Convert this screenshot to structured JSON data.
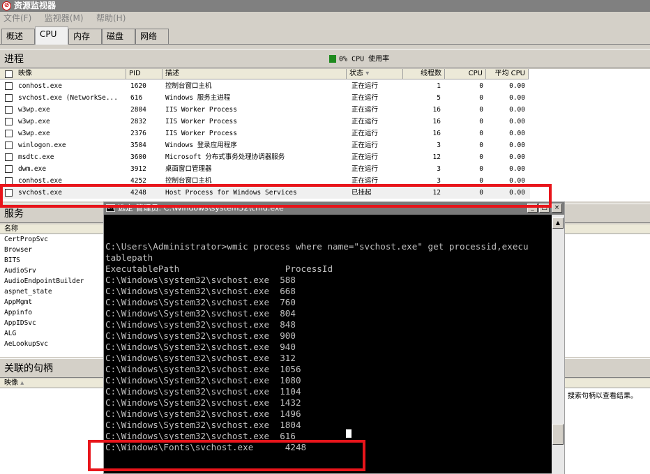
{
  "window": {
    "title": "资源监视器",
    "icon": "resource-monitor-icon"
  },
  "menu": [
    "文件(F)",
    "监视器(M)",
    "帮助(H)"
  ],
  "tabs": [
    "概述",
    "CPU",
    "内存",
    "磁盘",
    "网络"
  ],
  "active_tab": "CPU",
  "processes": {
    "title": "进程",
    "legend": "0% CPU 使用率",
    "legend_color": "#1e8a1e",
    "columns": [
      "映像",
      "PID",
      "描述",
      "状态",
      "线程数",
      "CPU",
      "平均 CPU"
    ],
    "rows": [
      [
        "conhost.exe",
        "1620",
        "控制台窗口主机",
        "正在运行",
        "1",
        "0",
        "0.00"
      ],
      [
        "svchost.exe (NetworkSe...",
        "616",
        "Windows 服务主进程",
        "正在运行",
        "5",
        "0",
        "0.00"
      ],
      [
        "w3wp.exe",
        "2804",
        "IIS Worker Process",
        "正在运行",
        "16",
        "0",
        "0.00"
      ],
      [
        "w3wp.exe",
        "2832",
        "IIS Worker Process",
        "正在运行",
        "16",
        "0",
        "0.00"
      ],
      [
        "w3wp.exe",
        "2376",
        "IIS Worker Process",
        "正在运行",
        "16",
        "0",
        "0.00"
      ],
      [
        "winlogon.exe",
        "3504",
        "Windows 登录应用程序",
        "正在运行",
        "3",
        "0",
        "0.00"
      ],
      [
        "msdtc.exe",
        "3600",
        "Microsoft 分布式事务处理协调器服务",
        "正在运行",
        "12",
        "0",
        "0.00"
      ],
      [
        "dwm.exe",
        "3912",
        "桌面窗口管理器",
        "正在运行",
        "3",
        "0",
        "0.00"
      ],
      [
        "conhost.exe",
        "4252",
        "控制台窗口主机",
        "正在运行",
        "3",
        "0",
        "0.00"
      ],
      [
        "svchost.exe",
        "4248",
        "Host Process for Windows Services",
        "已挂起",
        "12",
        "0",
        "0.00"
      ]
    ]
  },
  "services": {
    "title": "服务",
    "column": "名称",
    "items": [
      "CertPropSvc",
      "Browser",
      "BITS",
      "AudioSrv",
      "AudioEndpointBuilder",
      "aspnet_state",
      "AppMgmt",
      "Appinfo",
      "AppIDSvc",
      "ALG",
      "AeLookupSvc"
    ]
  },
  "handles": {
    "title": "关联的句柄",
    "column": "映像",
    "hint": "搜索句柄以查看结果。"
  },
  "cmd": {
    "title": "选定 管理员: C:\\Windows\\system32\\cmd.exe",
    "lines": [
      "C:\\Users\\Administrator>wmic process where name=\"svchost.exe\" get processid,execu",
      "tablepath",
      "ExecutablePath                    ProcessId",
      "C:\\Windows\\system32\\svchost.exe  588",
      "C:\\Windows\\system32\\svchost.exe  668",
      "C:\\Windows\\System32\\svchost.exe  760",
      "C:\\Windows\\System32\\svchost.exe  804",
      "C:\\Windows\\system32\\svchost.exe  848",
      "C:\\Windows\\system32\\svchost.exe  900",
      "C:\\Windows\\System32\\svchost.exe  940",
      "C:\\Windows\\system32\\svchost.exe  312",
      "C:\\Windows\\system32\\svchost.exe  1056",
      "C:\\Windows\\System32\\svchost.exe  1080",
      "C:\\Windows\\system32\\svchost.exe  1104",
      "C:\\Windows\\System32\\svchost.exe  1432",
      "C:\\Windows\\system32\\svchost.exe  1496",
      "C:\\Windows\\System32\\svchost.exe  1804",
      "C:\\Windows\\system32\\svchost.exe  616",
      "C:\\Windows\\Fonts\\svchost.exe      4248"
    ]
  },
  "highlight_color": "#e8151b"
}
